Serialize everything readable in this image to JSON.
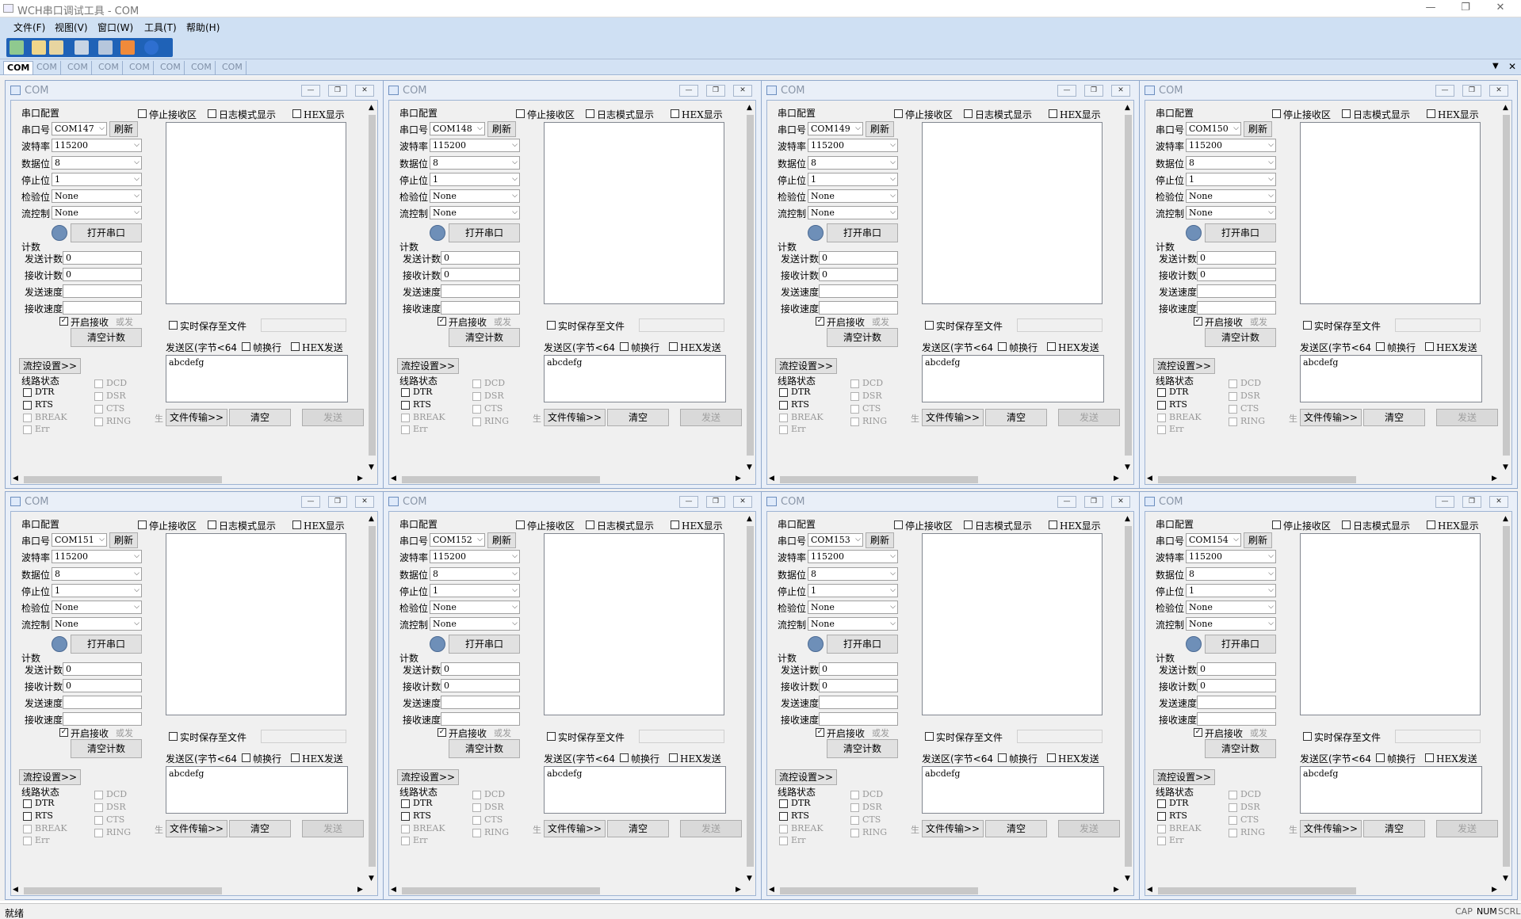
{
  "app": {
    "title": "WCH串口调试工具 - COM",
    "win_min": "—",
    "win_restore": "❐",
    "win_close": "✕"
  },
  "menu": [
    "文件(F)",
    "视图(V)",
    "窗口(W)",
    "工具(T)",
    "帮助(H)"
  ],
  "tabs": [
    "COM",
    "COM",
    "COM",
    "COM",
    "COM",
    "COM",
    "COM",
    "COM"
  ],
  "labels": {
    "win_title": "COM",
    "serial_config": "串口配置",
    "port": "串口号",
    "refresh": "刷新",
    "baud": "波特率",
    "databits": "数据位",
    "stopbits": "停止位",
    "parity": "检验位",
    "flow": "流控制",
    "open_port": "打开串口",
    "count": "计数",
    "send_count": "发送计数",
    "recv_count": "接收计数",
    "send_speed": "发送速度",
    "recv_speed": "接收速度",
    "enable_recv": "开启接收",
    "clear_count": "清空计数",
    "flow_settings": "流控设置>>",
    "line_status": "线路状态",
    "dtr": "DTR",
    "rts": "RTS",
    "break": "BREAK",
    "err": "Err",
    "dcd": "DCD",
    "dsr": "DSR",
    "cts": "CTS",
    "ring": "RING",
    "stop_recv_area": "停止接收区",
    "log_mode": "日志模式显示",
    "hex_display": "HEX显示",
    "save_to_file": "实时保存至文件",
    "send_area": "发送区(字节<64",
    "frame_newline": "帧换行",
    "hex_send": "HEX发送",
    "file_transfer": "文件传输>>",
    "clear": "清空",
    "send": "发送",
    "overlap1": "或发",
    "overlap2": "生"
  },
  "ports": [
    {
      "port": "COM147",
      "baud": "115200",
      "databits": "8",
      "stopbits": "1",
      "parity": "None",
      "flow": "None",
      "send_count": "0",
      "recv_count": "0",
      "send_text": "abcdefg",
      "enable_recv": true
    },
    {
      "port": "COM148",
      "baud": "115200",
      "databits": "8",
      "stopbits": "1",
      "parity": "None",
      "flow": "None",
      "send_count": "0",
      "recv_count": "0",
      "send_text": "abcdefg",
      "enable_recv": true
    },
    {
      "port": "COM149",
      "baud": "115200",
      "databits": "8",
      "stopbits": "1",
      "parity": "None",
      "flow": "None",
      "send_count": "0",
      "recv_count": "0",
      "send_text": "abcdefg",
      "enable_recv": true
    },
    {
      "port": "COM150",
      "baud": "115200",
      "databits": "8",
      "stopbits": "1",
      "parity": "None",
      "flow": "None",
      "send_count": "0",
      "recv_count": "0",
      "send_text": "abcdefg",
      "enable_recv": true
    },
    {
      "port": "COM151",
      "baud": "115200",
      "databits": "8",
      "stopbits": "1",
      "parity": "None",
      "flow": "None",
      "send_count": "0",
      "recv_count": "0",
      "send_text": "abcdefg",
      "enable_recv": true
    },
    {
      "port": "COM152",
      "baud": "115200",
      "databits": "8",
      "stopbits": "1",
      "parity": "None",
      "flow": "None",
      "send_count": "0",
      "recv_count": "0",
      "send_text": "abcdefg",
      "enable_recv": true
    },
    {
      "port": "COM153",
      "baud": "115200",
      "databits": "8",
      "stopbits": "1",
      "parity": "None",
      "flow": "None",
      "send_count": "0",
      "recv_count": "0",
      "send_text": "abcdefg",
      "enable_recv": true
    },
    {
      "port": "COM154",
      "baud": "115200",
      "databits": "8",
      "stopbits": "1",
      "parity": "None",
      "flow": "None",
      "send_count": "0",
      "recv_count": "0",
      "send_text": "abcdefg",
      "enable_recv": true
    }
  ],
  "status": {
    "text": "就绪",
    "cap": "CAP",
    "num": "NUM",
    "scrl": "SCRL"
  }
}
